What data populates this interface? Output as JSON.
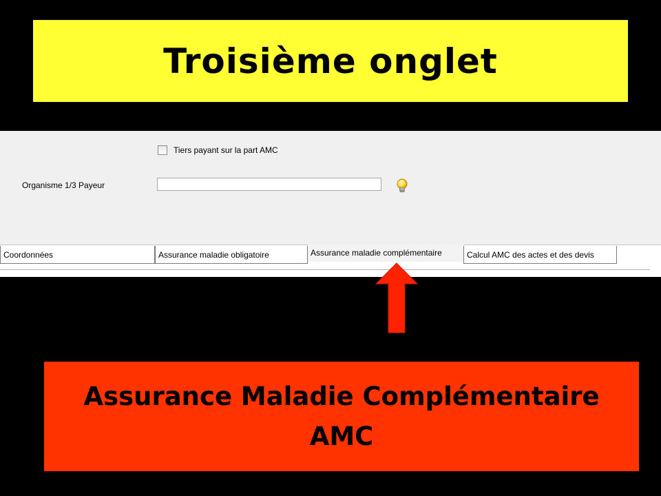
{
  "title": "Troisième onglet",
  "form": {
    "checkbox_label": "Tiers payant sur la part AMC",
    "checkbox_checked": false,
    "field_label": "Organisme 1/3 Payeur",
    "field_value": ""
  },
  "tabs": [
    {
      "label": "Coordonnées",
      "active": false
    },
    {
      "label": "Assurance maladie obligatoire",
      "active": false
    },
    {
      "label": "Assurance maladie complémentaire",
      "active": true
    },
    {
      "label": "Calcul AMC des actes et des devis",
      "active": false
    }
  ],
  "caption": {
    "line1": "Assurance Maladie Complémentaire",
    "line2": "AMC"
  },
  "colors": {
    "title_bg": "#ffff33",
    "caption_bg": "#ff3300",
    "arrow": "#ff2200",
    "background": "#000000"
  },
  "icons": {
    "hint": "lightbulb-icon",
    "pointer": "arrow-up-icon"
  }
}
